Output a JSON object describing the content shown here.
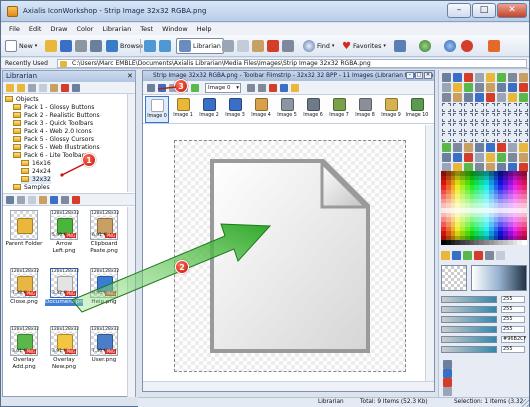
{
  "app": {
    "title": "Axialis IconWorkshop - Strip Image 32x32 RGBA.png",
    "minimize": "–",
    "maximize": "□",
    "close": "✕"
  },
  "menu": [
    "File",
    "Edit",
    "Draw",
    "Color",
    "Librarian",
    "Test",
    "Window",
    "Help"
  ],
  "toolbar": {
    "new": "New",
    "browse": "Browse",
    "librarian": "Librarian",
    "find": "Find",
    "favorites": "Favorites"
  },
  "recent": {
    "label": "Recently Used",
    "path": "C:\\Users\\Marc EMBLE\\Documents\\Axialis Librarian\\Media Files\\Images\\Strip Image 32x32 RGBA.png"
  },
  "librarian": {
    "header": "Librarian",
    "tree": [
      {
        "label": "Objects",
        "level": 1
      },
      {
        "label": "Pack 1 - Glossy Buttons",
        "level": 2
      },
      {
        "label": "Pack 2 - Realistic Buttons",
        "level": 2
      },
      {
        "label": "Pack 3 - Quick Toolbars",
        "level": 2
      },
      {
        "label": "Pack 4 - Web 2.0 Icons",
        "level": 2
      },
      {
        "label": "Pack 5 - Glossy Cursors",
        "level": 2
      },
      {
        "label": "Pack 5 - Web Illustrations",
        "level": 2
      },
      {
        "label": "Pack 6 - Lite Toolbars",
        "level": 2
      },
      {
        "label": "16x16",
        "level": 3
      },
      {
        "label": "24x24",
        "level": 3
      },
      {
        "label": "32x32",
        "level": 3
      },
      {
        "label": "Samples",
        "level": 2
      }
    ],
    "items": [
      {
        "label": "Parent Folder",
        "dims": "",
        "size": "",
        "png": "",
        "icon": "parent-folder-icon",
        "color": "#e9b73a"
      },
      {
        "label": "Arrow Left.png",
        "dims": "128x128x32",
        "size": "5.99 Kb",
        "png": "PNG",
        "icon": "arrow-left-icon",
        "color": "#49b53d"
      },
      {
        "label": "Clipboard Paste.png",
        "dims": "128x128x32",
        "size": "6.91 Kb",
        "png": "PNG",
        "icon": "clipboard-icon",
        "color": "#c9a064"
      },
      {
        "label": "Close.png",
        "dims": "128x128x32",
        "size": "7.38 Kb",
        "png": "PNG",
        "icon": "folder-icon",
        "color": "#e8b743"
      },
      {
        "label": "Document.png",
        "dims": "128x128x32",
        "size": "3.32 Kb",
        "png": "PNG",
        "icon": "document-icon",
        "color": "#e4e4e4"
      },
      {
        "label": "Help.png",
        "dims": "128x128x32",
        "size": "9.90 Kb",
        "png": "PNG",
        "icon": "help-icon",
        "color": "#3a7dd6"
      },
      {
        "label": "Overlay Add.png",
        "dims": "128x128x32",
        "size": "3.01 Kb",
        "png": "PNG",
        "icon": "overlay-add-icon",
        "color": "#5ab84a"
      },
      {
        "label": "Overlay New.png",
        "dims": "128x128x32",
        "size": "3.91 Kb",
        "png": "PNG",
        "icon": "overlay-new-icon",
        "color": "#f2c640"
      },
      {
        "label": "User.png",
        "dims": "128x128x32",
        "size": "7.39 Kb",
        "png": "PNG",
        "icon": "user-icon",
        "color": "#4a7ec8"
      }
    ]
  },
  "document": {
    "title": "Strip Image 32x32 RGBA.png - Toolbar Filmstrip - 32x32 32 BPP - 11 Images (Librarian folder \"Images\")",
    "frame_select": "Image 0",
    "frames": [
      {
        "label": "Image 0",
        "icon": "document-icon",
        "color": "#ffffff"
      },
      {
        "label": "Image 1",
        "icon": "folder-open-icon",
        "color": "#e9b73a"
      },
      {
        "label": "Image 2",
        "icon": "save-icon",
        "color": "#3a6fc6"
      },
      {
        "label": "Image 3",
        "icon": "save-as-icon",
        "color": "#3a6fc6"
      },
      {
        "label": "Image 4",
        "icon": "edit-icon",
        "color": "#d8a24a"
      },
      {
        "label": "Image 5",
        "icon": "print-icon",
        "color": "#8c95a2"
      },
      {
        "label": "Image 6",
        "icon": "printer-icon",
        "color": "#6e7a88"
      },
      {
        "label": "Image 7",
        "icon": "printer-check-icon",
        "color": "#7aa04a"
      },
      {
        "label": "Image 8",
        "icon": "fax-icon",
        "color": "#8a8f98"
      },
      {
        "label": "Image 9",
        "icon": "mail-icon",
        "color": "#d4b24e"
      },
      {
        "label": "Image 10",
        "icon": "mail-forward-icon",
        "color": "#5b9a4f"
      }
    ]
  },
  "tools": {
    "fields": [
      {
        "value": "255"
      },
      {
        "value": "255"
      },
      {
        "value": "255"
      },
      {
        "value": "255"
      },
      {
        "value": "#96B2CF"
      },
      {
        "value": "255"
      }
    ]
  },
  "status": {
    "lib": "Librarian",
    "total": "Total: 9 Items (52.3 Kb)",
    "selection": "Selection: 1 Items (3.32 Kb)"
  },
  "callouts": {
    "one": "1",
    "two": "2",
    "three": "3"
  },
  "colors": {
    "accent": "#3a76c8",
    "callout": "#d42a1d",
    "arrow": "#2fa829"
  }
}
